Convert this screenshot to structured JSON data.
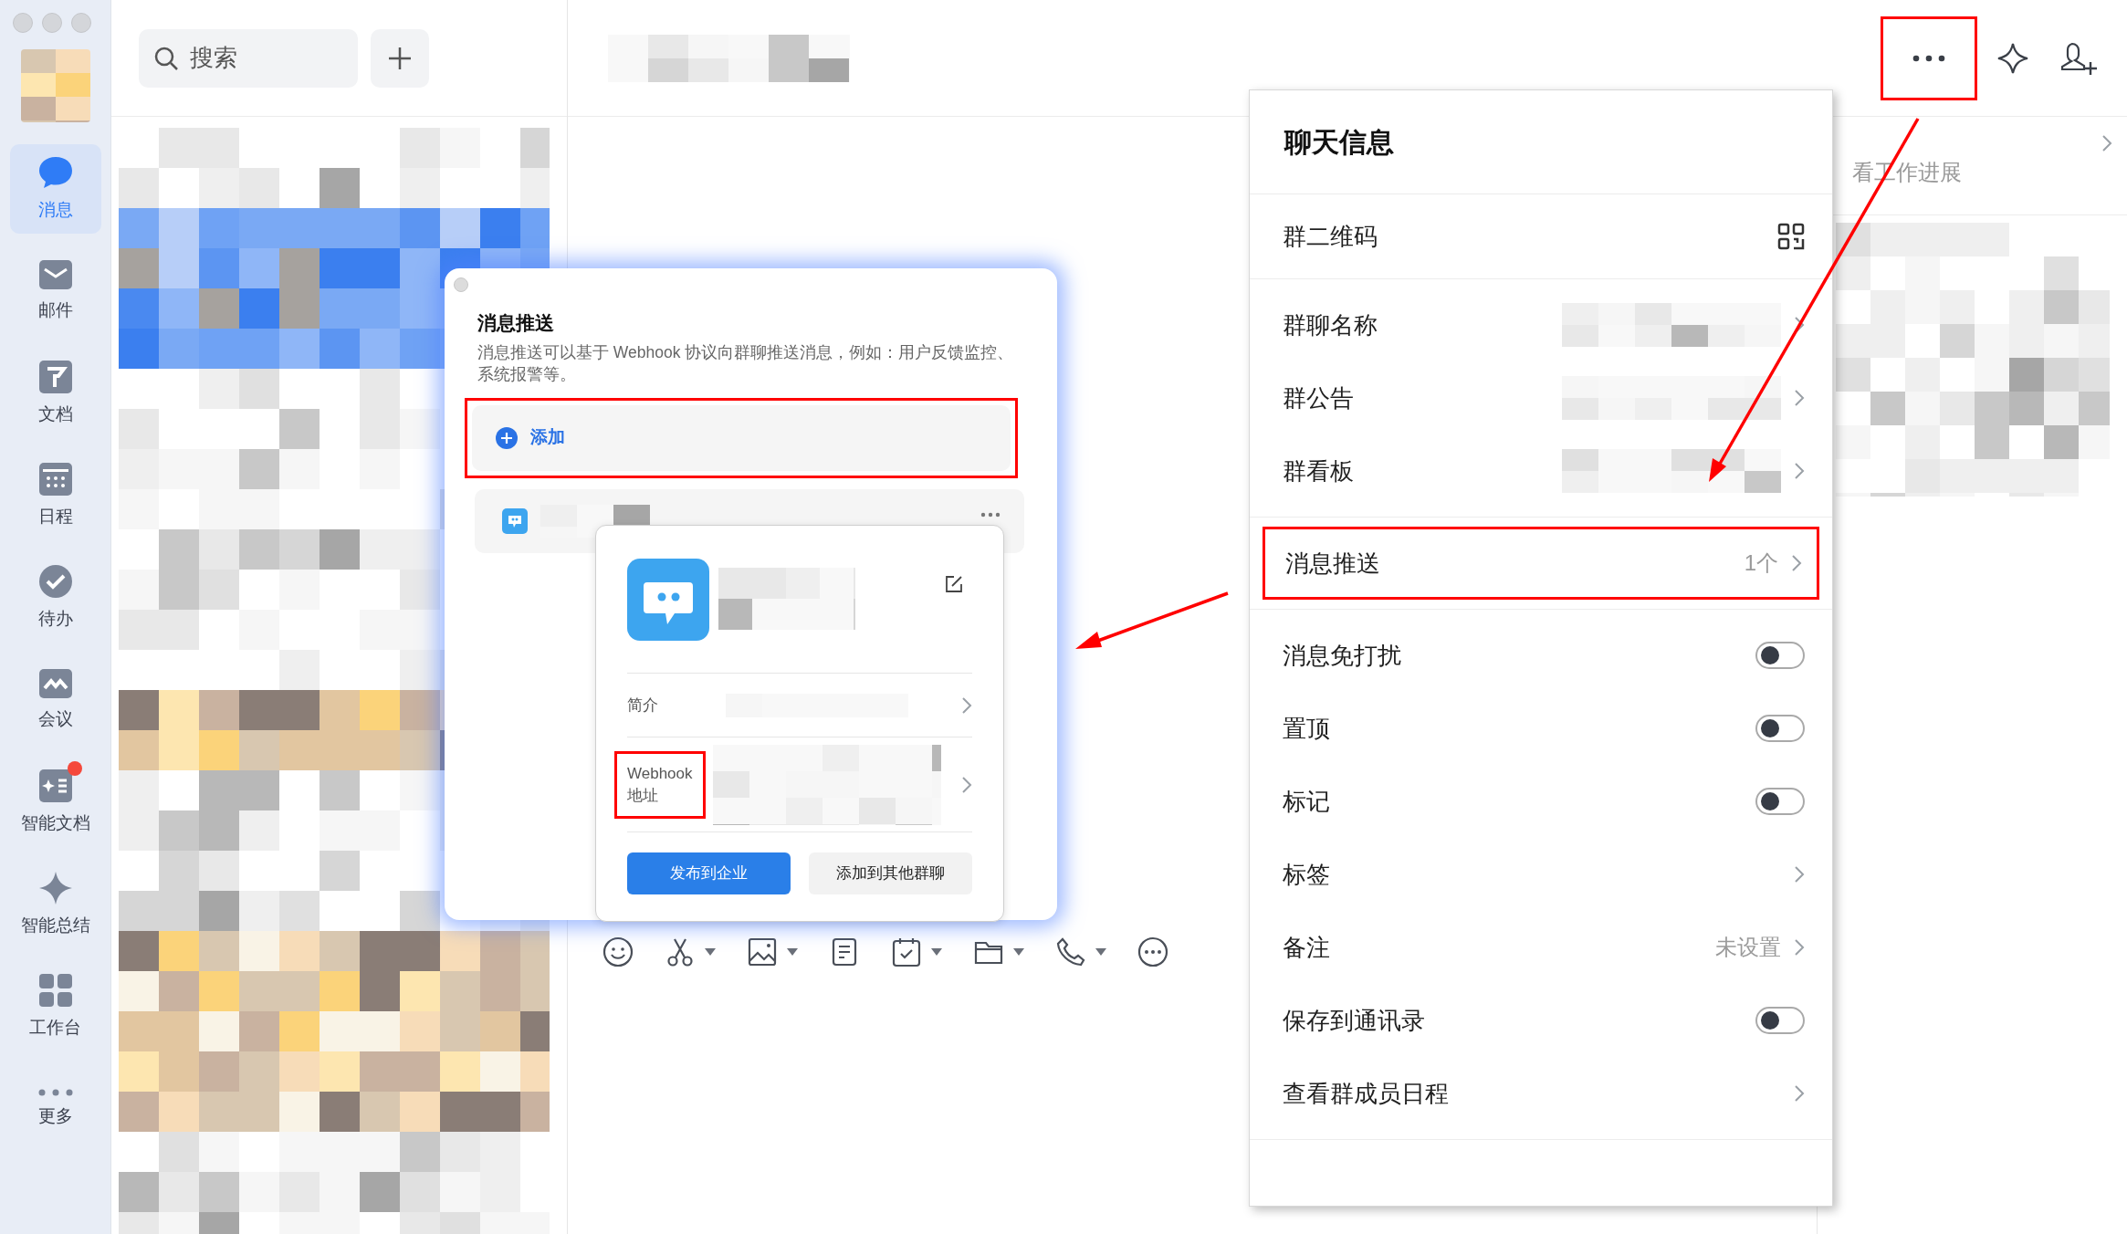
{
  "nav": [
    {
      "label": "消息",
      "selected": true,
      "badge": false
    },
    {
      "label": "邮件",
      "selected": false,
      "badge": false
    },
    {
      "label": "文档",
      "selected": false,
      "badge": false
    },
    {
      "label": "日程",
      "selected": false,
      "badge": false
    },
    {
      "label": "待办",
      "selected": false,
      "badge": false
    },
    {
      "label": "会议",
      "selected": false,
      "badge": false
    },
    {
      "label": "智能文档",
      "selected": false,
      "badge": true
    },
    {
      "label": "智能总结",
      "selected": false,
      "badge": false
    },
    {
      "label": "工作台",
      "selected": false,
      "badge": false
    },
    {
      "label": "更多",
      "selected": false,
      "badge": false
    }
  ],
  "search": {
    "placeholder": "搜索"
  },
  "header": {
    "more_highlighted": true
  },
  "side_panel": {
    "subtitle": "看工作进展"
  },
  "toolbar": [
    {
      "kind": "emoji",
      "dropdown": false
    },
    {
      "kind": "scissors",
      "dropdown": true
    },
    {
      "kind": "image",
      "dropdown": true
    },
    {
      "kind": "document",
      "dropdown": false
    },
    {
      "kind": "calendar",
      "dropdown": true
    },
    {
      "kind": "folder",
      "dropdown": true
    },
    {
      "kind": "phone",
      "dropdown": true
    },
    {
      "kind": "more",
      "dropdown": false
    }
  ],
  "chat_info": {
    "title": "聊天信息",
    "sections": [
      [
        {
          "kind": "qr",
          "label": "群二维码",
          "highlighted": false
        }
      ],
      [
        {
          "kind": "link",
          "label": "群聊名称",
          "value_hidden": true,
          "highlighted": false
        },
        {
          "kind": "link",
          "label": "群公告",
          "value_hidden": true,
          "highlighted": false
        },
        {
          "kind": "link",
          "label": "群看板",
          "value_hidden": true,
          "highlighted": false
        }
      ],
      [
        {
          "kind": "link",
          "label": "消息推送",
          "value": "1个",
          "value_hidden": false,
          "highlighted": true
        }
      ],
      [
        {
          "kind": "toggle",
          "label": "消息免打扰",
          "on": false,
          "highlighted": false
        },
        {
          "kind": "toggle",
          "label": "置顶",
          "on": false,
          "highlighted": false
        },
        {
          "kind": "toggle",
          "label": "标记",
          "on": false,
          "highlighted": false
        },
        {
          "kind": "link",
          "label": "标签",
          "value_hidden": false,
          "highlighted": false
        },
        {
          "kind": "link",
          "label": "备注",
          "value": "未设置",
          "value_hidden": false,
          "highlighted": false
        },
        {
          "kind": "toggle",
          "label": "保存到通讯录",
          "on": false,
          "highlighted": false
        },
        {
          "kind": "link",
          "label": "查看群成员日程",
          "value_hidden": false,
          "highlighted": false
        }
      ]
    ]
  },
  "push_dialog": {
    "title": "消息推送",
    "description": "消息推送可以基于 Webhook 协议向群聊推送消息，例如：用户反馈监控、系统报警等。",
    "add": {
      "label": "添加",
      "highlighted": true
    },
    "bot": {
      "fields": [
        {
          "label": "简介",
          "highlighted": false
        },
        {
          "label": "Webhook 地址",
          "highlighted": true
        }
      ],
      "buttons": [
        {
          "label": "发布到企业",
          "primary": true
        },
        {
          "label": "添加到其他群聊",
          "primary": false
        }
      ]
    }
  }
}
